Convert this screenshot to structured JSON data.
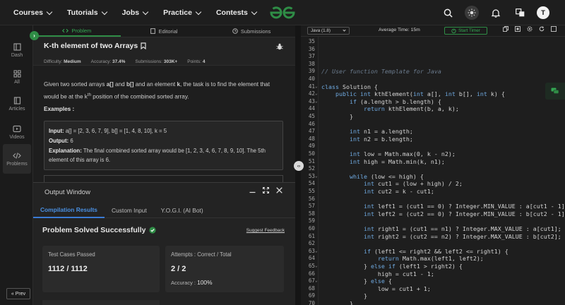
{
  "nav": {
    "items": [
      {
        "label": "Courses"
      },
      {
        "label": "Tutorials"
      },
      {
        "label": "Jobs"
      },
      {
        "label": "Practice"
      },
      {
        "label": "Contests"
      }
    ],
    "avatar_letter": "T"
  },
  "sidebar": {
    "items": [
      {
        "label": "Dash",
        "icon": "dashboard-icon"
      },
      {
        "label": "All",
        "icon": "grid-icon"
      },
      {
        "label": "Articles",
        "icon": "book-icon"
      },
      {
        "label": "Videos",
        "icon": "video-icon"
      },
      {
        "label": "Problems",
        "icon": "code-icon"
      }
    ],
    "prev_label": "Prev"
  },
  "problem_tabs": [
    {
      "label": "Problem"
    },
    {
      "label": "Editorial"
    },
    {
      "label": "Submissions"
    }
  ],
  "problem": {
    "title": "K-th element of two Arrays",
    "difficulty_label": "Difficulty:",
    "difficulty": "Medium",
    "accuracy_label": "Accuracy:",
    "accuracy": "37.4%",
    "submissions_label": "Submissions:",
    "submissions": "303K+",
    "points_label": "Points:",
    "points": "4",
    "desc_1": "Given two sorted arrays ",
    "desc_a": "a[]",
    "desc_2": " and ",
    "desc_b": "b[]",
    "desc_3": " and an element ",
    "desc_k": "k",
    "desc_4": ", the task is to find the element that would be at the k",
    "desc_sup": "th",
    "desc_5": " position of the combined sorted array.",
    "examples_label": "Examples :",
    "example": {
      "input_label": "Input:",
      "input": " a[] = [2, 3, 6, 7, 9], b[] = [1, 4, 8, 10], k = 5",
      "output_label": "Output:",
      "output": " 6",
      "explanation_label": "Explanation:",
      "explanation": " The final combined sorted array would be [1, 2, 3, 4, 6, 7, 8, 9, 10]. The 5th element of this array is 6."
    }
  },
  "output": {
    "title": "Output Window",
    "tabs": [
      {
        "label": "Compilation Results"
      },
      {
        "label": "Custom Input"
      },
      {
        "label": "Y.O.G.I. (AI Bot)"
      }
    ],
    "status": "Problem Solved Successfully",
    "suggest": "Suggest Feedback",
    "cards": {
      "tests_label": "Test Cases Passed",
      "tests_value": "1112 / 1112",
      "attempts_label": "Attempts : Correct / Total",
      "attempts_value": "2 / 2",
      "accuracy_label": "Accuracy :",
      "accuracy_value": "100%"
    }
  },
  "editor": {
    "language": "Java (1.8)",
    "avg_time": "Average Time: 15m",
    "timer_label": "Start Timer",
    "lines": [
      {
        "n": "35",
        "code": ""
      },
      {
        "n": "36",
        "code": ""
      },
      {
        "n": "37",
        "code": ""
      },
      {
        "n": "38",
        "code": ""
      },
      {
        "n": "39",
        "code": "// User function Template for Java"
      },
      {
        "n": "40",
        "code": ""
      },
      {
        "n": "41",
        "code": "class Solution {"
      },
      {
        "n": "42",
        "code": "    public int kthElement(int a[], int b[], int k) {"
      },
      {
        "n": "43",
        "code": "        if (a.length > b.length) {"
      },
      {
        "n": "44",
        "code": "            return kthElement(b, a, k);"
      },
      {
        "n": "45",
        "code": "        }"
      },
      {
        "n": "46",
        "code": ""
      },
      {
        "n": "47",
        "code": "        int n1 = a.length;"
      },
      {
        "n": "48",
        "code": "        int n2 = b.length;"
      },
      {
        "n": "49",
        "code": ""
      },
      {
        "n": "50",
        "code": "        int low = Math.max(0, k - n2);"
      },
      {
        "n": "51",
        "code": "        int high = Math.min(k, n1);"
      },
      {
        "n": "52",
        "code": ""
      },
      {
        "n": "53",
        "code": "        while (low <= high) {"
      },
      {
        "n": "54",
        "code": "            int cut1 = (low + high) / 2;"
      },
      {
        "n": "55",
        "code": "            int cut2 = k - cut1;"
      },
      {
        "n": "56",
        "code": ""
      },
      {
        "n": "57",
        "code": "            int left1 = (cut1 == 0) ? Integer.MIN_VALUE : a[cut1 - 1];"
      },
      {
        "n": "58",
        "code": "            int left2 = (cut2 == 0) ? Integer.MIN_VALUE : b[cut2 - 1];"
      },
      {
        "n": "59",
        "code": ""
      },
      {
        "n": "60",
        "code": "            int right1 = (cut1 == n1) ? Integer.MAX_VALUE : a[cut1];"
      },
      {
        "n": "61",
        "code": "            int right2 = (cut2 == n2) ? Integer.MAX_VALUE : b[cut2];"
      },
      {
        "n": "62",
        "code": ""
      },
      {
        "n": "63",
        "code": "            if (left1 <= right2 && left2 <= right1) {"
      },
      {
        "n": "64",
        "code": "                return Math.max(left1, left2);"
      },
      {
        "n": "65",
        "code": "            } else if (left1 > right2) {"
      },
      {
        "n": "66",
        "code": "                high = cut1 - 1;"
      },
      {
        "n": "67",
        "code": "            } else {"
      },
      {
        "n": "68",
        "code": "                low = cut1 + 1;"
      },
      {
        "n": "69",
        "code": "            }"
      },
      {
        "n": "70",
        "code": "        }"
      }
    ]
  },
  "colors": {
    "accent_green": "#2f8d46",
    "link_blue": "#3a7bd5",
    "keyword": "#6fa9e0",
    "comment": "#6a7a8c"
  }
}
